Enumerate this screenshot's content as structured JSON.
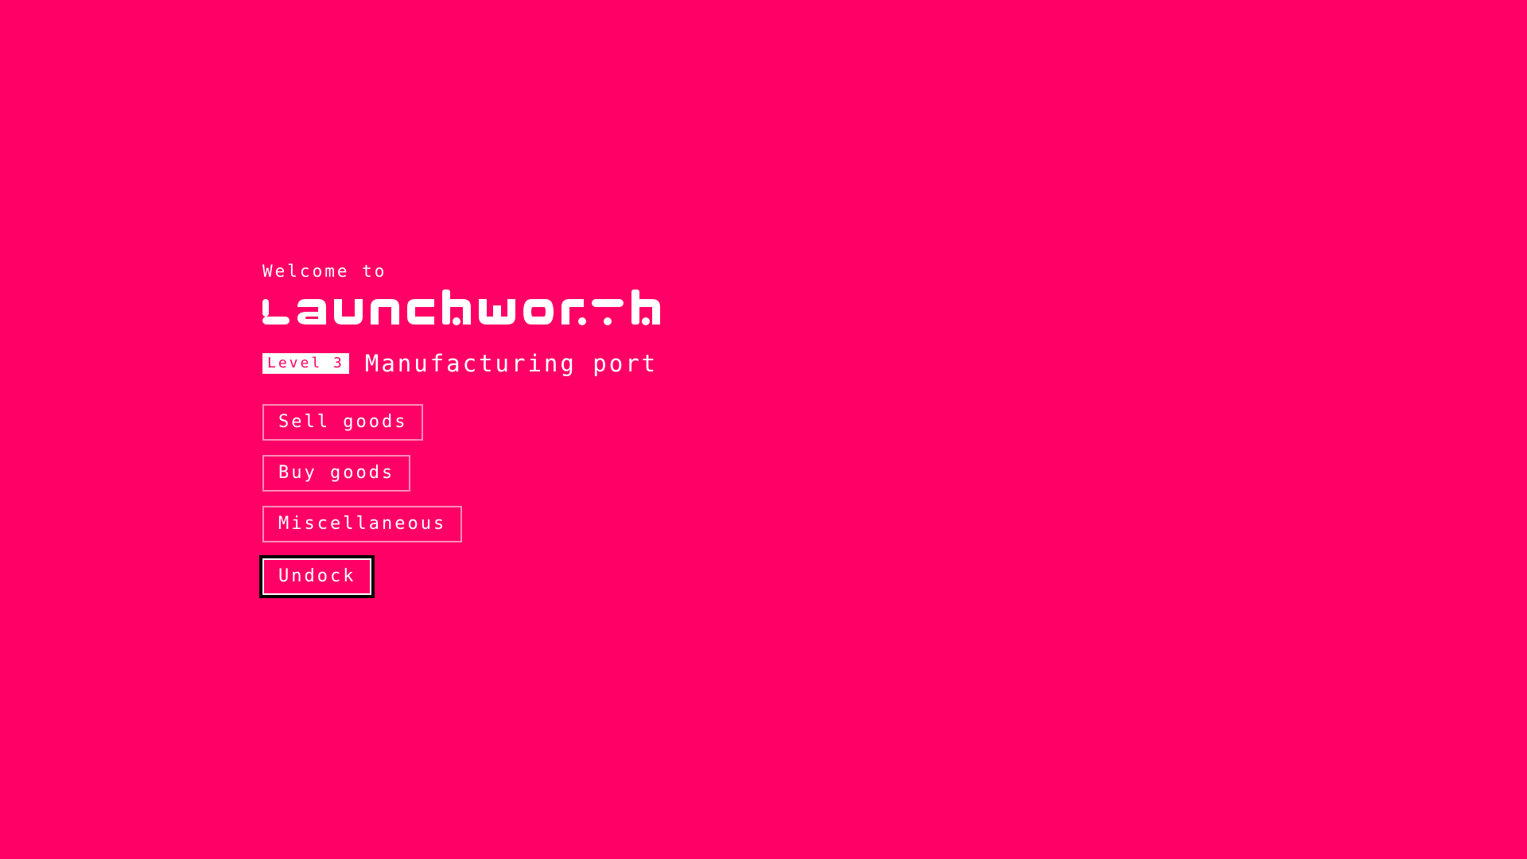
{
  "header": {
    "welcome_text": "Welcome to",
    "logo_text": "launchworth"
  },
  "port": {
    "level_badge": "Level 3",
    "type": "Manufacturing port"
  },
  "menu": {
    "items": [
      {
        "label": "Sell goods"
      },
      {
        "label": "Buy goods"
      },
      {
        "label": "Miscellaneous"
      },
      {
        "label": "Undock",
        "focused": true
      }
    ]
  },
  "colors": {
    "background": "#ff0066",
    "foreground": "#ffffff",
    "focus_outline": "#000000"
  }
}
